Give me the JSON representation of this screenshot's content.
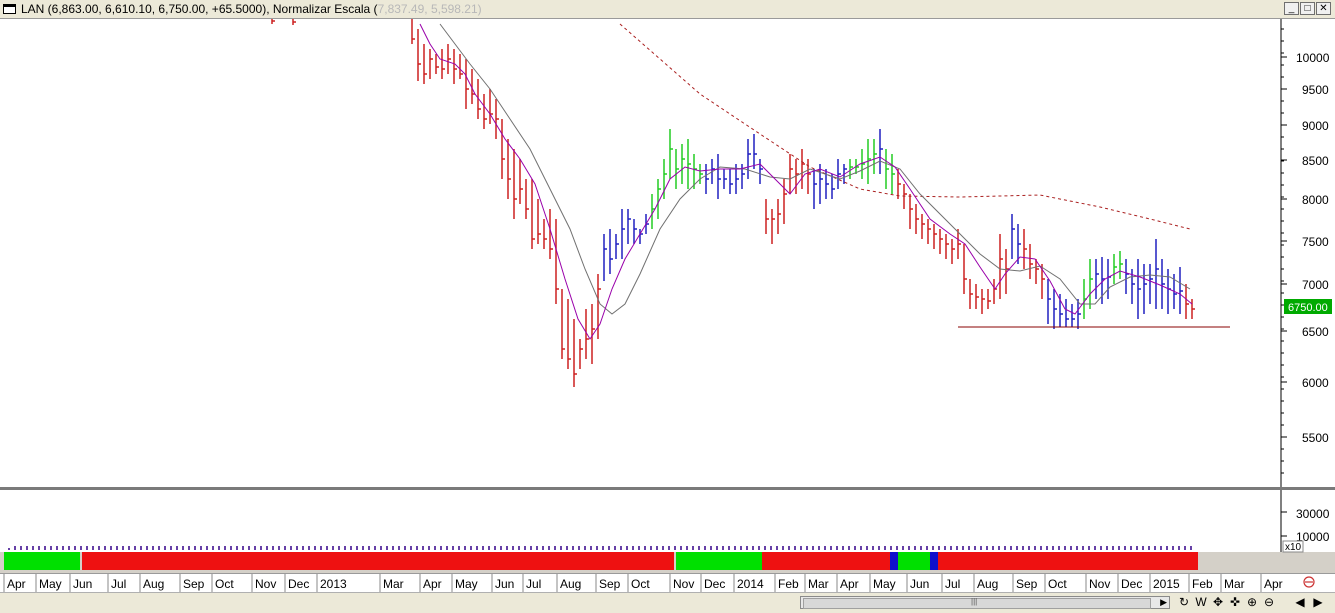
{
  "window": {
    "symbol_info": "LAN (6,863.00, 6,610.10, 6,750.00, +65.5000), Normalizar Escala (",
    "scale_range": "7,837.49, 5,598.21",
    "close_paren": ")",
    "buttons": [
      "_",
      "□",
      "✕"
    ]
  },
  "price_axis": {
    "labels": [
      "10000",
      "9500",
      "9000",
      "8500",
      "8000",
      "7500",
      "7000",
      "6500",
      "6000",
      "5500"
    ],
    "last_price": "6750.00"
  },
  "volume_axis": {
    "labels": [
      "30000",
      "10000"
    ],
    "multiplier": "x10"
  },
  "time_axis": {
    "labels": [
      "Apr",
      "May",
      "Jun",
      "Jul",
      "Aug",
      "Sep",
      "Oct",
      "Nov",
      "Dec",
      "2013",
      "Mar",
      "Apr",
      "May",
      "Jun",
      "Jul",
      "Aug",
      "Sep",
      "Oct",
      "Nov",
      "Dec",
      "2014",
      "Feb",
      "Mar",
      "Apr",
      "May",
      "Jun",
      "Jul",
      "Aug",
      "Sep",
      "Oct",
      "Nov",
      "Dec",
      "2015",
      "Feb",
      "Mar",
      "Apr"
    ]
  },
  "toolbar": {
    "scroll_grip": "|||",
    "icons": [
      "refresh-icon",
      "weekly-icon",
      "move-icon",
      "crosshair-icon",
      "zoom-in-icon",
      "zoom-out-icon",
      "scroll-left-icon",
      "scroll-right-icon"
    ],
    "glyphs": [
      "↻",
      "W",
      "✥",
      "✜",
      "⊕",
      "⊖",
      "◀",
      "▶"
    ]
  },
  "colors": {
    "up_bar": "#22cc22",
    "neutral_bar": "#2020c0",
    "down_bar": "#cc2020",
    "fast_ma": "#9900aa",
    "slow_ma": "#707070",
    "long_ma": "#aa2020",
    "support_line": "#880000",
    "last_price_bg": "#00aa00"
  },
  "chart_data": {
    "type": "ohlc",
    "ylim": [
      5000,
      10400
    ],
    "support_level": 6550,
    "price_series": [
      {
        "date": "2012-06",
        "close": 10600
      },
      {
        "date": "2013-03",
        "close": 10400
      },
      {
        "date": "2013-04",
        "close": 9700
      },
      {
        "date": "2013-05",
        "close": 9200
      },
      {
        "date": "2013-06",
        "close": 8700
      },
      {
        "date": "2013-07",
        "close": 7600
      },
      {
        "date": "2013-08",
        "close": 6300
      },
      {
        "date": "2013-09",
        "close": 7200
      },
      {
        "date": "2013-10",
        "close": 7800
      },
      {
        "date": "2013-11",
        "close": 8600
      },
      {
        "date": "2013-12",
        "close": 8300
      },
      {
        "date": "2014-01",
        "close": 8400
      },
      {
        "date": "2014-02",
        "close": 7700
      },
      {
        "date": "2014-03",
        "close": 8200
      },
      {
        "date": "2014-04",
        "close": 8400
      },
      {
        "date": "2014-05",
        "close": 8700
      },
      {
        "date": "2014-06",
        "close": 7900
      },
      {
        "date": "2014-07",
        "close": 7400
      },
      {
        "date": "2014-08",
        "close": 6800
      },
      {
        "date": "2014-09",
        "close": 7400
      },
      {
        "date": "2014-10",
        "close": 6700
      },
      {
        "date": "2014-11",
        "close": 7100
      },
      {
        "date": "2014-12",
        "close": 7000
      },
      {
        "date": "2015-01",
        "close": 6900
      },
      {
        "date": "2015-02",
        "close": 6750
      }
    ],
    "long_ma": [
      {
        "date": "2013-09",
        "value": 10400
      },
      {
        "date": "2014-01",
        "value": 8900
      },
      {
        "date": "2014-04",
        "value": 8200
      },
      {
        "date": "2014-06",
        "value": 8050
      },
      {
        "date": "2014-10",
        "value": 8050
      },
      {
        "date": "2015-01",
        "value": 7850
      },
      {
        "date": "2015-02",
        "value": 7650
      }
    ],
    "regime_bands": [
      {
        "from": "2012-04",
        "to": "2012-06",
        "state": "up"
      },
      {
        "from": "2012-06",
        "to": "2013-11",
        "state": "down"
      },
      {
        "from": "2013-11",
        "to": "2014-02",
        "state": "up"
      },
      {
        "from": "2014-02",
        "to": "2014-05",
        "state": "down"
      },
      {
        "from": "2014-05",
        "to": "2014-06",
        "state": "neutral"
      },
      {
        "from": "2014-06",
        "to": "2014-07",
        "state": "up"
      },
      {
        "from": "2014-07",
        "to": "2014-07",
        "state": "neutral"
      },
      {
        "from": "2014-07",
        "to": "2015-02",
        "state": "down"
      }
    ]
  }
}
